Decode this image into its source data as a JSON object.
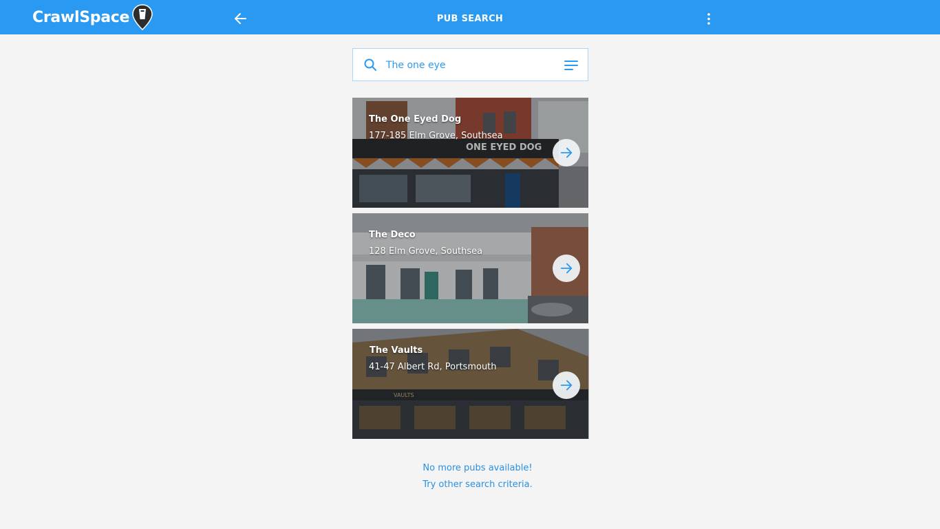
{
  "header": {
    "logo_text": "CrawlSpace",
    "title": "PUB SEARCH",
    "back_icon": "arrow-left-icon",
    "menu_icon": "more-vertical-icon",
    "bar_color": "#2a99f2"
  },
  "search": {
    "value": "The one eye",
    "placeholder": "",
    "icon": "search-icon",
    "filter_icon": "filter-lines-icon"
  },
  "results": [
    {
      "name": "The One Eyed Dog",
      "address": "177-185 Elm Grove, Southsea",
      "sign_text": "ONE EYED DOG"
    },
    {
      "name": "The Deco",
      "address": "128 Elm Grove, Southsea"
    },
    {
      "name": "The Vaults",
      "address": "41-47 Albert Rd, Portsmouth",
      "sign_text": "VAULTS"
    }
  ],
  "footer": {
    "line1": "No more pubs available!",
    "line2": "Try other search criteria."
  },
  "colors": {
    "accent": "#2a99f2",
    "background": "#f4f4f4"
  }
}
